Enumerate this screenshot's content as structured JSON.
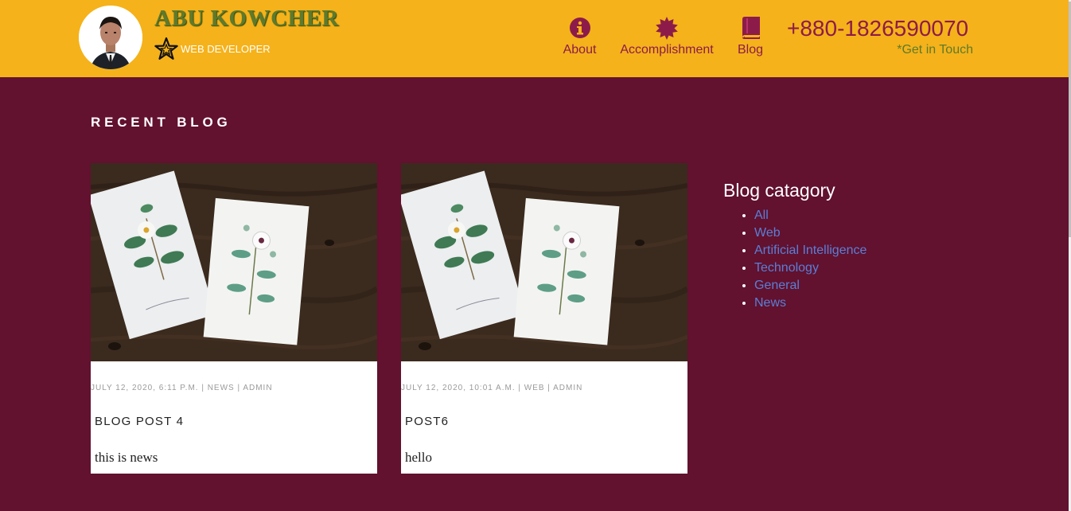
{
  "brand": {
    "name": "ABU KOWCHER",
    "role": "WEB DEVELOPER",
    "avatar_icon": "profile-photo"
  },
  "nav": {
    "items": [
      {
        "label": "About",
        "icon": "info-circle-icon"
      },
      {
        "label": "Accomplishment",
        "icon": "certificate-icon"
      },
      {
        "label": "Blog",
        "icon": "book-icon"
      }
    ]
  },
  "contact": {
    "phone": "+880-1826590070",
    "cta": "*Get in Touch"
  },
  "main": {
    "section_title": "RECENT BLOG",
    "posts": [
      {
        "meta": "JULY 12, 2020, 6:11 P.M. | NEWS | ADMIN",
        "title": "BLOG POST 4",
        "excerpt": "this is news"
      },
      {
        "meta": "JULY 12, 2020, 10:01 A.M. | WEB | ADMIN",
        "title": "POST6",
        "excerpt": "hello"
      }
    ]
  },
  "sidebar": {
    "heading": "Blog catagory",
    "categories": [
      "All",
      "Web",
      "Artificial Intelligence",
      "Technology",
      "General",
      "News"
    ]
  },
  "colors": {
    "header_bg": "#f5b21a",
    "page_bg": "#62112f",
    "accent": "#8d1b4a",
    "brand_green": "#5e7a2c",
    "link": "#5a7fd6"
  }
}
